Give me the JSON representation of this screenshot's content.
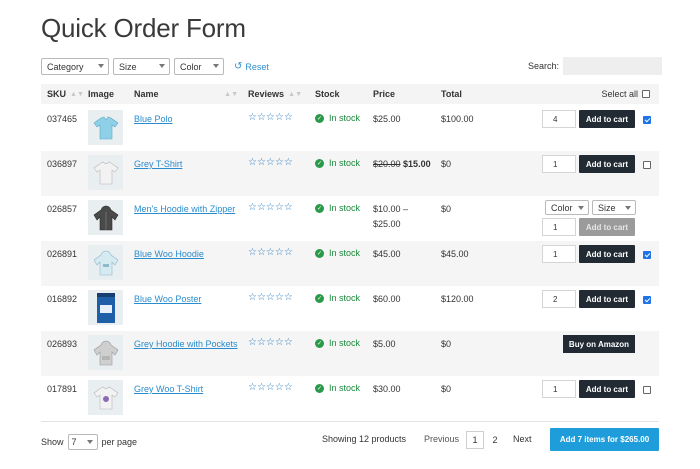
{
  "page": {
    "title": "Quick Order Form"
  },
  "filters": {
    "category": "Category",
    "size": "Size",
    "color": "Color",
    "reset": "Reset",
    "search_label": "Search:"
  },
  "columns": {
    "sku": "SKU",
    "image": "Image",
    "name": "Name",
    "reviews": "Reviews",
    "stock": "Stock",
    "price": "Price",
    "total": "Total",
    "select_all": "Select all"
  },
  "rows": [
    {
      "sku": "037465",
      "name": "Blue Polo",
      "stock": "In stock",
      "price": "$25.00",
      "total": "$100.00",
      "qty": "4",
      "button": "Add to cart",
      "checked": true
    },
    {
      "sku": "036897",
      "name": "Grey T-Shirt",
      "stock": "In stock",
      "price_old": "$20.00",
      "price": "$15.00",
      "total": "$0",
      "qty": "1",
      "button": "Add to cart",
      "checked": false
    },
    {
      "sku": "026857",
      "name": "Men's Hoodie with Zipper",
      "stock": "In stock",
      "price": "$10.00 –",
      "price_line2": "$25.00",
      "total": "$0",
      "qty": "1",
      "button": "Add to cart",
      "color_select": "Color",
      "size_select": "Size",
      "checked": false
    },
    {
      "sku": "026891",
      "name": "Blue Woo Hoodie",
      "stock": "In stock",
      "price": "$45.00",
      "total": "$45.00",
      "qty": "1",
      "button": "Add to cart",
      "checked": true
    },
    {
      "sku": "016892",
      "name": "Blue Woo Poster",
      "stock": "In stock",
      "price": "$60.00",
      "total": "$120.00",
      "qty": "2",
      "button": "Add to cart",
      "checked": true
    },
    {
      "sku": "026893",
      "name": "Grey Hoodie with Pockets",
      "stock": "In stock",
      "price": "$5.00",
      "total": "$0",
      "button": "Buy on Amazon"
    },
    {
      "sku": "017891",
      "name": "Grey Woo T-Shirt",
      "stock": "In stock",
      "price": "$30.00",
      "total": "$0",
      "qty": "1",
      "button": "Add to cart",
      "checked": false
    }
  ],
  "footer": {
    "show_label": "Show",
    "show_value": "7",
    "per_page": "per page",
    "showing": "Showing 12 products",
    "previous": "Previous",
    "page1": "1",
    "page2": "2",
    "next": "Next",
    "add_all": "Add 7 items for $265.00"
  },
  "icons": {
    "stars": "☆☆☆☆☆",
    "stock": "in-stock-check-icon"
  },
  "colors": {
    "link": "#2a8ccd",
    "button": "#222b33",
    "primary": "#1f9ddb",
    "stock": "#1a8a3a"
  }
}
